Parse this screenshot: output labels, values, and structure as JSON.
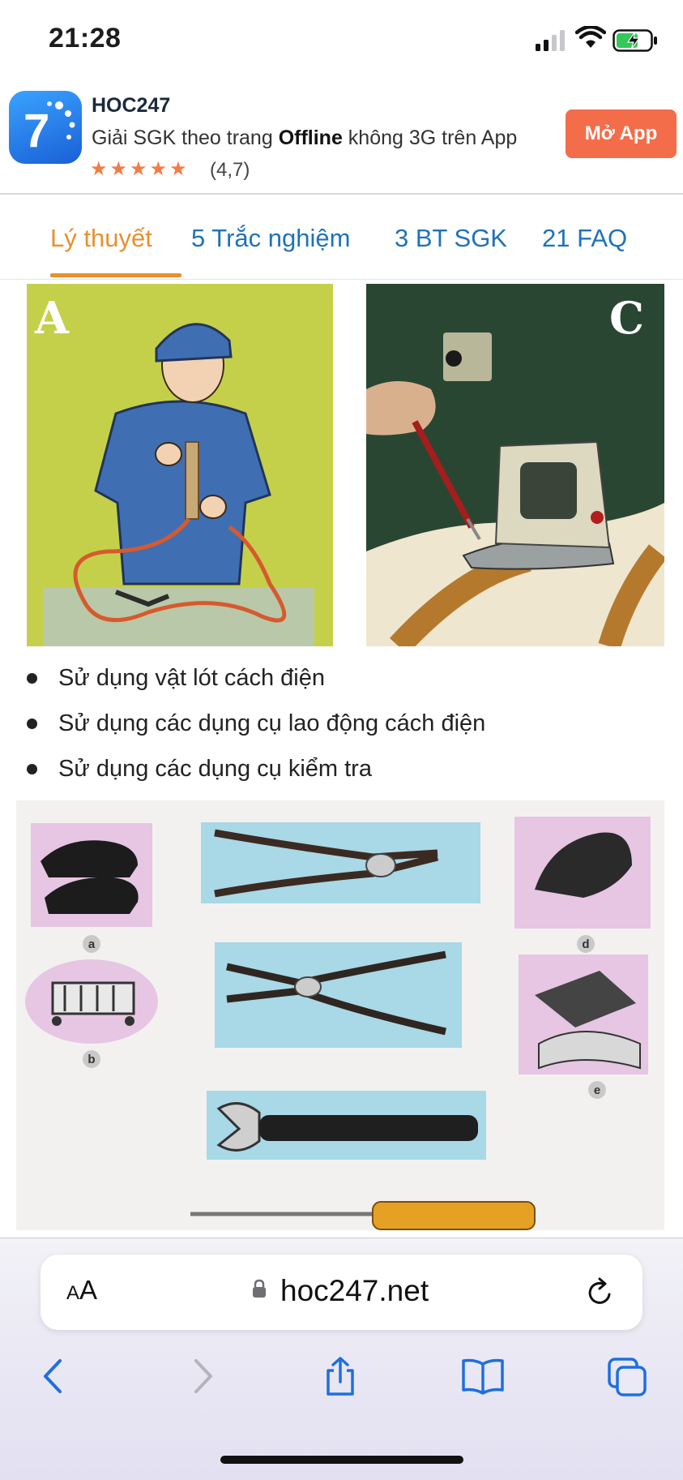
{
  "status_bar": {
    "time": "21:28",
    "icons": [
      "cellular-signal-icon",
      "wifi-icon",
      "battery-charging-icon"
    ]
  },
  "app_banner": {
    "icon_text": "7",
    "name": "HOC247",
    "tagline_prefix": "Giải SGK theo trang ",
    "tagline_bold": "Offline",
    "tagline_suffix": " không 3G trên App",
    "stars": "★★★★★",
    "rating": "(4,7)",
    "open_button": "Mở App"
  },
  "tabs": [
    {
      "label": "Lý thuyết",
      "active": true
    },
    {
      "label": "5 Trắc nghiệm",
      "active": false
    },
    {
      "label": "3 BT SGK",
      "active": false
    },
    {
      "label": "21 FAQ",
      "active": false
    }
  ],
  "photos": {
    "left_letter": "A",
    "right_letter": "C"
  },
  "bullets": [
    "Sử dụng vật lót cách điện",
    "Sử dụng các dụng cụ lao động cách điện",
    "Sử dụng các dụng cụ kiểm tra"
  ],
  "tool_labels": {
    "a": "a",
    "b": "b",
    "d": "d",
    "e": "e"
  },
  "browser": {
    "aa_label_small": "A",
    "aa_label_large": "A",
    "url": "hoc247.net",
    "icons": [
      "back-icon",
      "forward-icon",
      "share-icon",
      "bookmarks-icon",
      "tabs-icon"
    ]
  },
  "colors": {
    "tab_active": "#e8902f",
    "tab_inactive": "#1f72b8",
    "open_button": "#f36d4a",
    "stars": "#f47b44"
  }
}
